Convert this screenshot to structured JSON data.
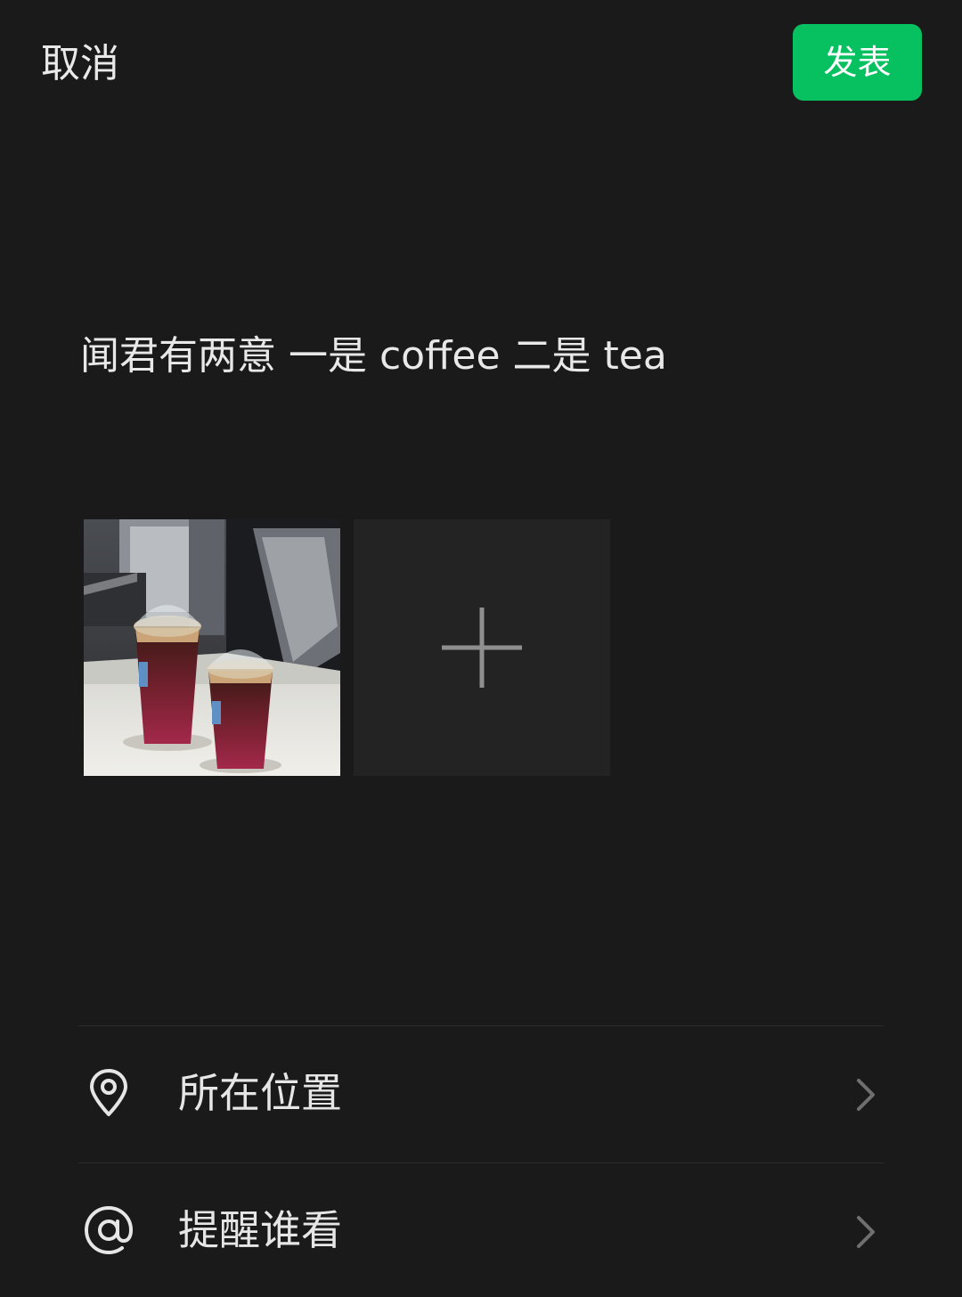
{
  "header": {
    "cancel_label": "取消",
    "publish_label": "发表"
  },
  "post": {
    "text": "闻君有两意 一是 coffee 二是 tea"
  },
  "media": {
    "photo_description_icon": "iced-drinks-photo",
    "add_icon": "plus-icon"
  },
  "options": [
    {
      "label": "所在位置",
      "icon": "location-pin-icon"
    },
    {
      "label": "提醒谁看",
      "icon": "at-sign-icon"
    }
  ],
  "colors": {
    "background": "#1a1a1a",
    "accent_green": "#07c160",
    "tile_background": "#232323",
    "divider": "#2c2c2c"
  }
}
